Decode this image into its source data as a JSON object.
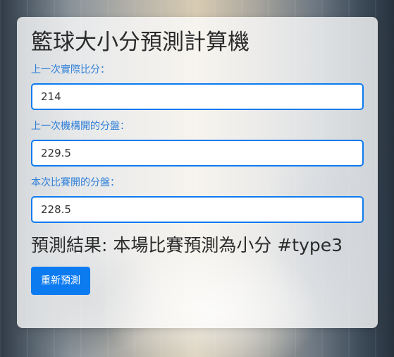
{
  "app": {
    "title": "籃球大小分預測計算機"
  },
  "form": {
    "fields": [
      {
        "label": "上一次實際比分：",
        "value": "214"
      },
      {
        "label": "上一次機構開的分盤：",
        "value": "229.5"
      },
      {
        "label": "本次比賽開的分盤：",
        "value": "228.5"
      }
    ]
  },
  "result": {
    "text": "預測結果: 本場比賽預測為小分 #type3"
  },
  "actions": {
    "reset_label": "重新預測"
  },
  "colors": {
    "accent": "#0d7bf0",
    "label_text": "#2f7fd8",
    "card_background": "rgba(255,255,255,0.78)"
  }
}
